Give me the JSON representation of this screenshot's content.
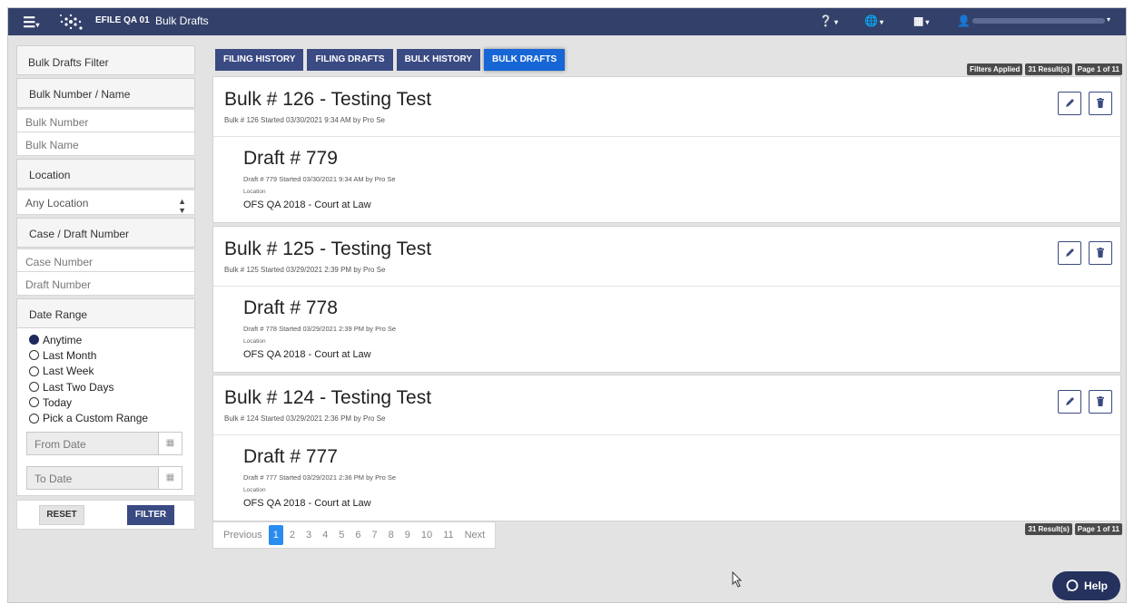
{
  "app": {
    "brand": "EFILE QA 01",
    "page_title": "Bulk Drafts"
  },
  "sidebar": {
    "filter_title": "Bulk Drafts Filter",
    "bulk_section": "Bulk Number / Name",
    "bulk_number_placeholder": "Bulk Number",
    "bulk_name_placeholder": "Bulk Name",
    "location_section": "Location",
    "location_value": "Any Location",
    "case_section": "Case / Draft Number",
    "case_number_placeholder": "Case Number",
    "draft_number_placeholder": "Draft Number",
    "date_section": "Date Range",
    "date_options": [
      "Anytime",
      "Last Month",
      "Last Week",
      "Last Two Days",
      "Today",
      "Pick a Custom Range"
    ],
    "date_selected": "Anytime",
    "from_date_placeholder": "From Date",
    "to_date_placeholder": "To Date",
    "reset_label": "RESET",
    "filter_label": "FILTER"
  },
  "tabs": [
    {
      "label": "FILING HISTORY",
      "active": false
    },
    {
      "label": "FILING DRAFTS",
      "active": false
    },
    {
      "label": "BULK HISTORY",
      "active": false
    },
    {
      "label": "BULK DRAFTS",
      "active": true
    }
  ],
  "status": {
    "filters_applied": "Filters Applied",
    "results": "31 Result(s)",
    "page": "Page 1 of 11"
  },
  "bulks": [
    {
      "title": "Bulk # 126 - Testing Test",
      "subtitle": "Bulk # 126 Started 03/30/2021 9:34 AM by Pro Se",
      "draft_title": "Draft # 779",
      "draft_subtitle": "Draft # 779 Started 03/30/2021 9:34 AM by Pro Se",
      "location_label": "Location",
      "location": "OFS QA 2018 - Court at Law"
    },
    {
      "title": "Bulk # 125 - Testing Test",
      "subtitle": "Bulk # 125 Started 03/29/2021 2:39 PM by Pro Se",
      "draft_title": "Draft # 778",
      "draft_subtitle": "Draft # 778 Started 03/29/2021 2:39 PM by Pro Se",
      "location_label": "Location",
      "location": "OFS QA 2018 - Court at Law"
    },
    {
      "title": "Bulk # 124 - Testing Test",
      "subtitle": "Bulk # 124 Started 03/29/2021 2:36 PM by Pro Se",
      "draft_title": "Draft # 777",
      "draft_subtitle": "Draft # 777 Started 03/29/2021 2:36 PM by Pro Se",
      "location_label": "Location",
      "location": "OFS QA 2018 - Court at Law"
    }
  ],
  "pagination": {
    "previous": "Previous",
    "pages": [
      "1",
      "2",
      "3",
      "4",
      "5",
      "6",
      "7",
      "8",
      "9",
      "10",
      "11"
    ],
    "current": "1",
    "next": "Next"
  },
  "help_label": "Help",
  "colors": {
    "topbar": "#33416a",
    "primary": "#3a4a82",
    "active_tab": "#1766d6",
    "page_current": "#2a8cf0"
  }
}
